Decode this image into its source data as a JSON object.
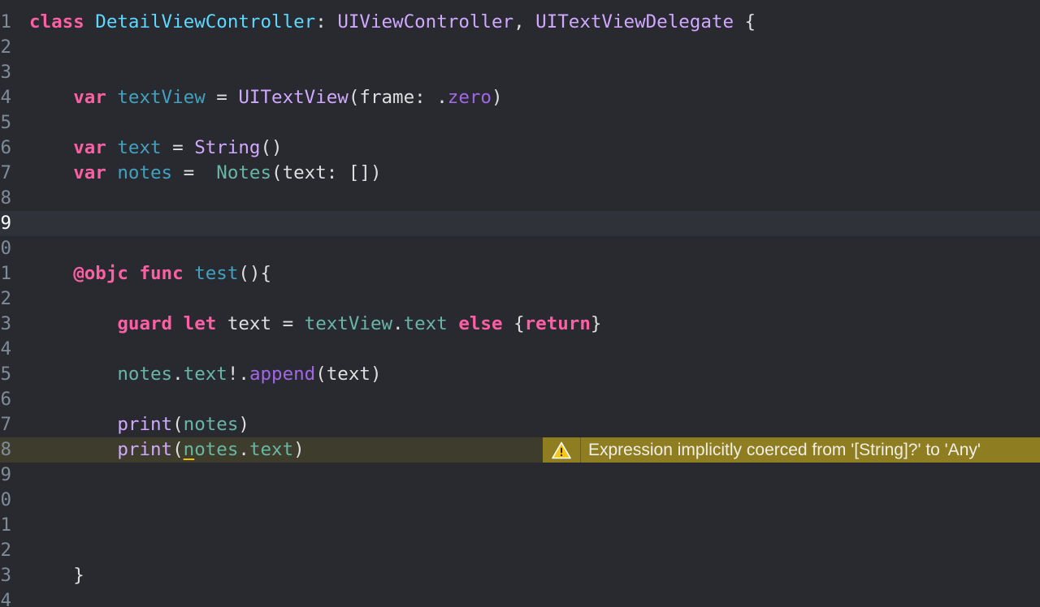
{
  "colors": {
    "background": "#292a30",
    "current_line": "#2f3239",
    "warning_line": "#3e3c2c",
    "warning_banner": "#8f7d22",
    "keyword": "#fc5fa3",
    "type_declaration": "#5dd8ff",
    "type": "#d0a8ff",
    "property_declaration": "#41a1c0",
    "property": "#67b7a4",
    "member": "#a167e6",
    "plain": "#dfdfe0",
    "line_number": "#7f8c98"
  },
  "line_numbers": [
    "1",
    "2",
    "3",
    "4",
    "5",
    "6",
    "7",
    "8",
    "9",
    "0",
    "1",
    "2",
    "3",
    "4",
    "5",
    "6",
    "7",
    "8",
    "9",
    "0",
    "1",
    "2",
    "3",
    "4"
  ],
  "code": {
    "l1": {
      "kw": "class",
      "name": "DetailViewController",
      "colon": ":",
      "super": "UIViewController",
      "comma": ",",
      "proto": "UITextViewDelegate",
      "brace": "{"
    },
    "l4": {
      "kw": "var",
      "name": "textView",
      "eq": "=",
      "type": "UITextView",
      "open": "(frame:",
      "dot": ".",
      "member": "zero",
      "close": ")"
    },
    "l6": {
      "kw": "var",
      "name": "text",
      "eq": "=",
      "type": "String",
      "parens": "()"
    },
    "l7": {
      "kw": "var",
      "name": "notes",
      "eq": "=",
      "type": "Notes",
      "args": "(text: [])"
    },
    "l11": {
      "attr": "@objc",
      "kw": "func",
      "name": "test",
      "rest": "(){"
    },
    "l13": {
      "kw1": "guard",
      "kw2": "let",
      "name": "text",
      "eq": "=",
      "obj": "textView",
      "dot": ".",
      "prop": "text",
      "kw3": "else",
      "open": "{",
      "kw4": "return",
      "close": "}"
    },
    "l15": {
      "obj": "notes",
      "dot": ".",
      "prop": "text",
      "bang": "!.",
      "method": "append",
      "args": "(text)"
    },
    "l17": {
      "fn": "print",
      "open": "(",
      "arg": "notes",
      "close": ")"
    },
    "l18": {
      "fn": "print",
      "open": "(",
      "arg_first": "n",
      "arg_rest": "otes",
      "dot": ".",
      "prop": "text",
      "close": ")"
    },
    "l23": {
      "brace": "}"
    }
  },
  "warning": {
    "icon": "warning-triangle-icon",
    "message": "Expression implicitly coerced from '[String]?' to 'Any'"
  }
}
